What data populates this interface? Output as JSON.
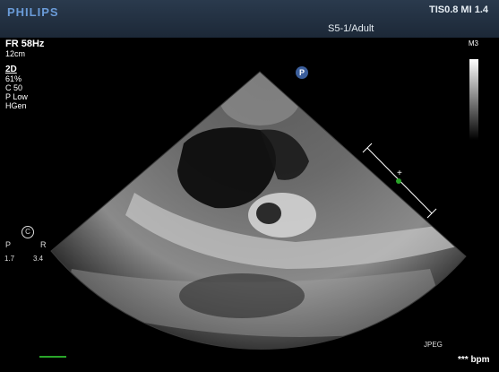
{
  "header": {
    "brand": "PHILIPS",
    "tis_mi": "TIS0.8   MI 1.4",
    "probe_preset": "S5-1/Adult"
  },
  "params": {
    "frame_rate": "FR 58Hz",
    "depth": "12cm",
    "mode": "2D",
    "gain": " 61%",
    "compress": "C 50",
    "power": "P Low",
    "resolution": "HGen"
  },
  "map": {
    "label": "M3"
  },
  "markers": {
    "orientation_marker": "P"
  },
  "orientation": {
    "circle_label": "C",
    "left": "P",
    "right": "R",
    "left_value": "1.7",
    "right_value": "3.4"
  },
  "footer": {
    "format": "JPEG",
    "heart_rate": "*** bpm"
  },
  "colors": {
    "header_bg": "#1c2837",
    "brand": "#6a9bd8",
    "marker": "#3c5f9c",
    "ecg": "#2aa52a",
    "caliper_dot": "#2aa52a"
  },
  "icons": [
    "orientation-marker-icon",
    "caliper-icon",
    "grayscale-bar-icon"
  ]
}
